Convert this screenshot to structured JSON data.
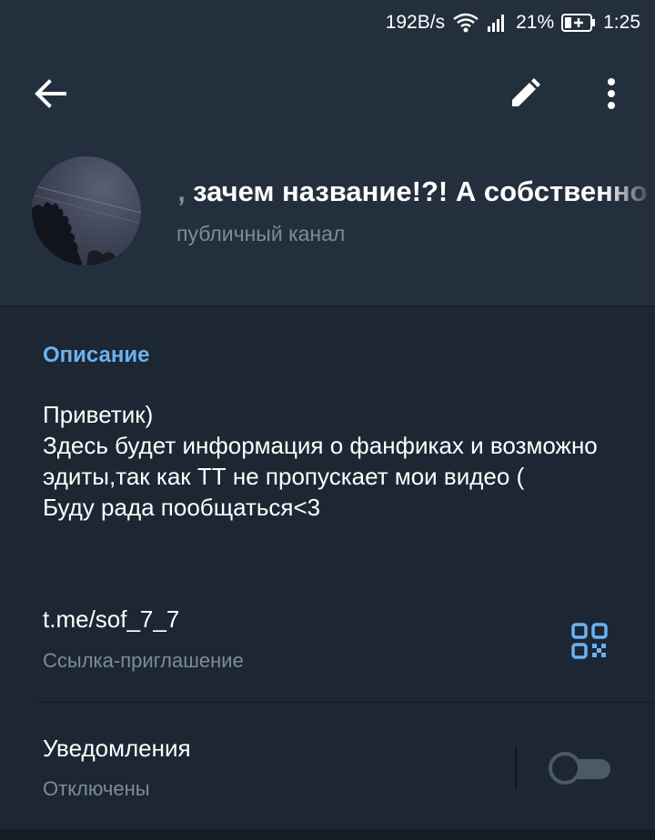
{
  "status_bar": {
    "speed": "192B/s",
    "battery_percent": "21%",
    "time": "1:25",
    "icons": [
      "wifi-icon",
      "signal-icon",
      "battery-charging-icon"
    ]
  },
  "toolbar": {
    "icons": [
      "back-arrow-icon",
      "pencil-edit-icon",
      "more-vertical-icon"
    ]
  },
  "channel": {
    "title": "о, зачем название!?!   А собственно",
    "subtitle": "публичный канал"
  },
  "description_section": {
    "title": "Описание",
    "text": "Приветик)\nЗдесь будет информация о фанфиках и возможно эдиты,так как ТТ не пропускает мои видео (\nБуду рада пообщаться<3"
  },
  "invite_link": {
    "url": "t.me/sof_7_7",
    "label": "Ссылка-приглашение",
    "icon": "qr-code-icon"
  },
  "notifications": {
    "title": "Уведомления",
    "status": "Отключены",
    "enabled": false
  },
  "colors": {
    "accent": "#6ab2f2",
    "header_bg": "#242f3d",
    "body_bg": "#1d2733",
    "secondary_text": "#7d8b99"
  }
}
